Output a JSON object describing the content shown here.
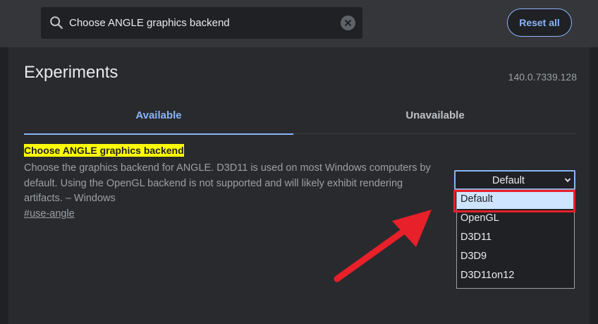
{
  "search": {
    "value": "Choose ANGLE graphics backend"
  },
  "header": {
    "reset_label": "Reset all"
  },
  "page": {
    "title": "Experiments",
    "version": "140.0.7339.128"
  },
  "tabs": [
    {
      "label": "Available"
    },
    {
      "label": "Unavailable"
    }
  ],
  "flag": {
    "title": "Choose ANGLE graphics backend",
    "description_lines": [
      "Choose the graphics backend for ANGLE. D3D11 is used on most Windows computers by",
      "default. Using the OpenGL backend is not supported and will likely exhibit rendering",
      "artifacts. – Windows"
    ],
    "link": "#use-angle",
    "selected_value": "Default",
    "options": [
      "Default",
      "OpenGL",
      "D3D11",
      "D3D9",
      "D3D11on12"
    ]
  },
  "colors": {
    "accent": "#8ab4f8",
    "highlight_yellow": "#ffff00",
    "annotation_red": "#e8202a"
  },
  "icons": {
    "search": "search-icon",
    "clear": "clear-icon",
    "chevron": "chevron-down-icon"
  }
}
